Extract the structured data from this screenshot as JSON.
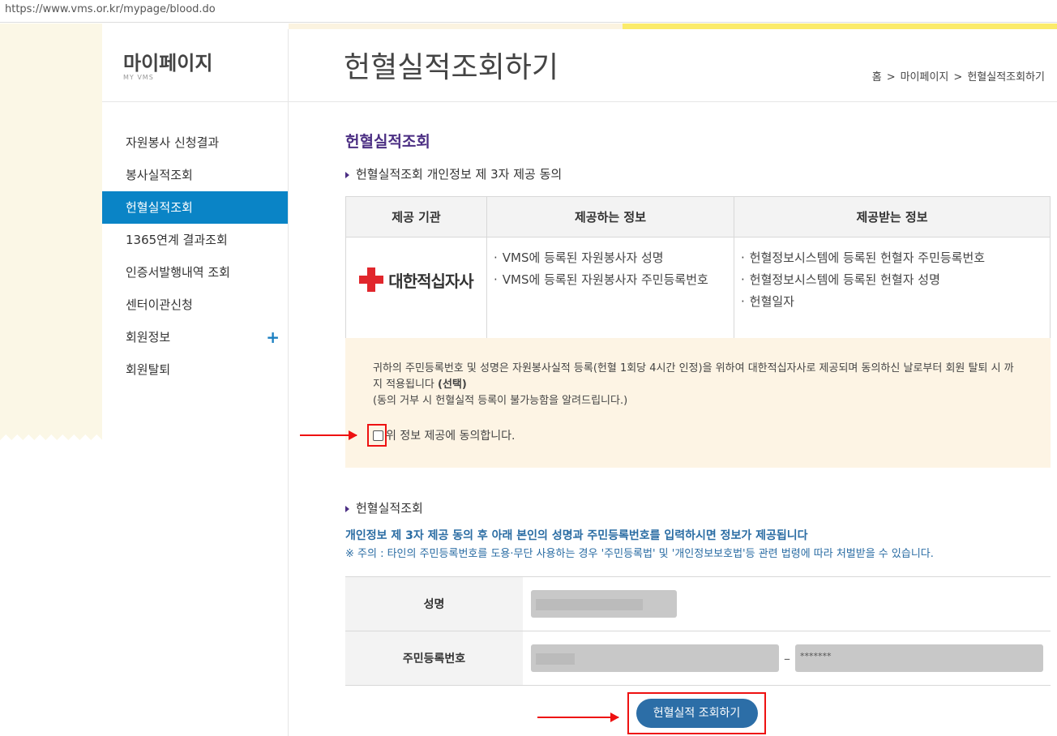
{
  "url": "https://www.vms.or.kr/mypage/blood.do",
  "sidebar": {
    "title": "마이페이지",
    "subtitle": "MY VMS",
    "items": [
      {
        "label": "자원봉사 신청결과"
      },
      {
        "label": "봉사실적조회"
      },
      {
        "label": "헌혈실적조회"
      },
      {
        "label": "1365연계 결과조회"
      },
      {
        "label": "인증서발행내역 조회"
      },
      {
        "label": "센터이관신청"
      },
      {
        "label": "회원정보"
      },
      {
        "label": "회원탈퇴"
      }
    ],
    "active_index": 2,
    "plus": "+"
  },
  "header": {
    "title": "헌혈실적조회하기",
    "breadcrumb": [
      "홈",
      "마이페이지",
      "헌혈실적조회하기"
    ],
    "separator": ">"
  },
  "section": {
    "title": "헌혈실적조회",
    "consent_heading": "헌혈실적조회 개인정보 제 3자 제공 동의",
    "table": {
      "headers": [
        "제공 기관",
        "제공하는 정보",
        "제공받는 정보"
      ],
      "org": "대한적십자사",
      "provided": [
        "VMS에 등록된 자원봉사자 성명",
        "VMS에 등록된 자원봉사자 주민등록번호"
      ],
      "received": [
        "헌혈정보시스템에 등록된 헌혈자 주민등록번호",
        "헌혈정보시스템에 등록된 헌혈자 성명",
        "헌혈일자"
      ]
    },
    "consent": {
      "text1": "귀하의 주민등록번호 및 성명은 자원봉사실적 등록(헌혈 1회당 4시간 인정)을 위하여 대한적십자사로 제공되며 동의하신 날로부터 회원 탈퇴 시 까지 적용됩니다 ",
      "text1_bold": "(선택)",
      "text2": "(동의 거부 시 헌혈실적 등록이 불가능함을 알려드립니다.)",
      "agree_label": "위 정보 제공에 동의합니다.",
      "checked": false
    },
    "lookup_heading": "헌혈실적조회",
    "guide": "개인정보 제 3자 제공 동의 후 아래 본인의 성명과 주민등록번호를 입력하시면 정보가 제공됩니다",
    "warning": "※ 주의 : 타인의 주민등록번호를 도용·무단 사용하는 경우 '주민등록법' 및 '개인정보보호법'등 관련 법령에 따라 처벌받을 수 있습니다.",
    "form": {
      "name_label": "성명",
      "rrn_label": "주민등록번호",
      "rrn_dash": "–",
      "rrn_back": "*******"
    },
    "submit_label": "헌혈실적 조회하기"
  },
  "colors": {
    "active_menu": "#0a84c6",
    "title_purple": "#4b2e83",
    "guide_blue": "#2a6ca3",
    "button": "#2c6ea7",
    "highlight_red": "#ee1111"
  }
}
